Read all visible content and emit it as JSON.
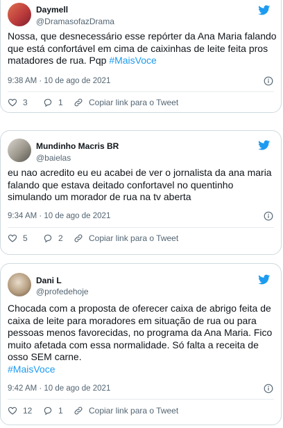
{
  "colors": {
    "accent": "#1d9bf0",
    "muted": "#536471",
    "border": "#cfd9de"
  },
  "tweets": [
    {
      "name": "Daymell",
      "handle": "@DramasofazDrama",
      "text": "Nossa, que desnecessário esse repórter da Ana Maria falando que está confortável em cima de caixinhas de leite feita pros matadores de rua. Pqp ",
      "hashtag": "#MaisVoce",
      "timestamp": "9:38 AM · 10 de ago de 2021",
      "likes": "3",
      "replies": "1",
      "copy_link": "Copiar link para o Tweet",
      "icons": [
        "avatar",
        "twitter-bird-icon",
        "info-icon",
        "heart-icon",
        "reply-icon",
        "link-icon"
      ]
    },
    {
      "name": "Mundinho Macris BR",
      "handle": "@baielas",
      "text": "eu nao acredito eu eu acabei de ver o jornalista da ana maria falando que estava deitado confortavel no quentinho simulando um morador de rua na tv aberta",
      "timestamp": "9:34 AM · 10 de ago de 2021",
      "likes": "5",
      "replies": "2",
      "copy_link": "Copiar link para o Tweet"
    },
    {
      "name": "Dani L",
      "handle": "@profedehoje",
      "text": "Chocada com a proposta de oferecer caixa de abrigo feita de caixa de leite para moradores em situação de rua ou para pessoas menos favorecidas, no programa da Ana Maria. Fico muito afetada com essa normalidade. Só falta a receita de osso SEM carne.",
      "hashtag": "#MaisVoce",
      "timestamp": "9:42 AM · 10 de ago de 2021",
      "likes": "12",
      "replies": "1",
      "copy_link": "Copiar link para o Tweet"
    }
  ]
}
